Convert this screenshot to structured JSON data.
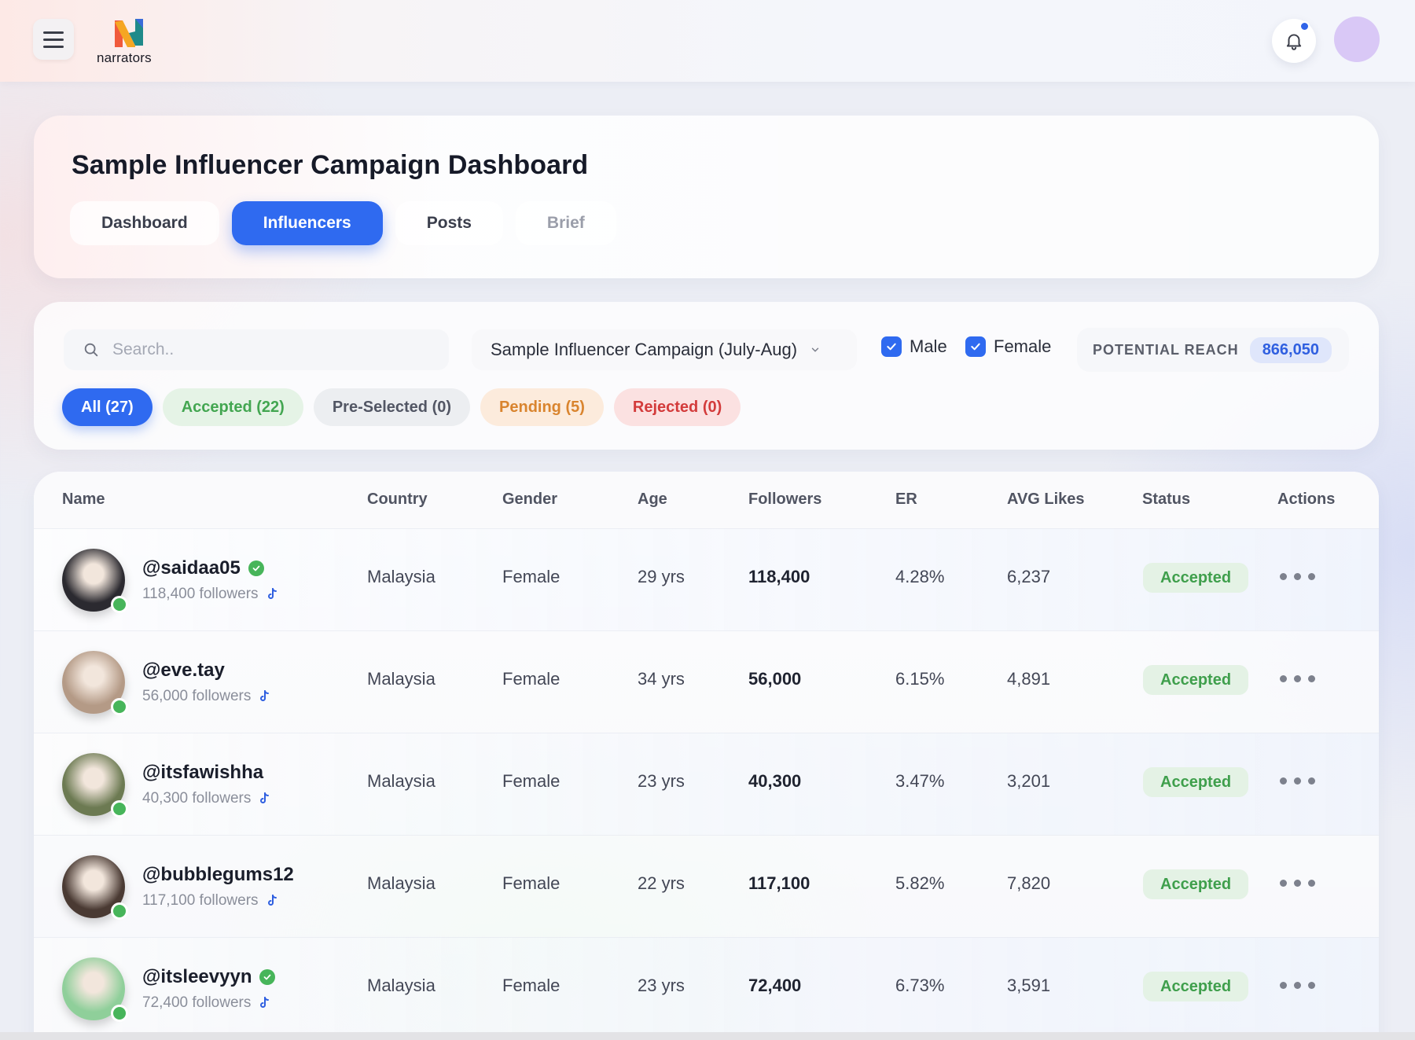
{
  "brand": {
    "name": "narrators"
  },
  "page": {
    "title": "Sample Influencer Campaign Dashboard"
  },
  "tabs": [
    {
      "label": "Dashboard",
      "state": "default"
    },
    {
      "label": "Influencers",
      "state": "active"
    },
    {
      "label": "Posts",
      "state": "default"
    },
    {
      "label": "Brief",
      "state": "muted"
    }
  ],
  "filters": {
    "search_placeholder": "Search..",
    "campaign": "Sample Influencer Campaign (July-Aug)",
    "gender_male": {
      "label": "Male",
      "checked": true
    },
    "gender_female": {
      "label": "Female",
      "checked": true
    },
    "potential_reach_label": "POTENTIAL REACH",
    "potential_reach_value": "866,050",
    "status_pills": [
      {
        "label": "All (27)",
        "kind": "all"
      },
      {
        "label": "Accepted (22)",
        "kind": "acc"
      },
      {
        "label": "Pre-Selected (0)",
        "kind": "pre"
      },
      {
        "label": "Pending (5)",
        "kind": "pen"
      },
      {
        "label": "Rejected (0)",
        "kind": "rej"
      }
    ]
  },
  "table": {
    "columns": {
      "name": "Name",
      "country": "Country",
      "gender": "Gender",
      "age": "Age",
      "followers": "Followers",
      "er": "ER",
      "avg_likes": "AVG Likes",
      "status": "Status",
      "actions": "Actions"
    },
    "rows": [
      {
        "handle": "@saidaa05",
        "verified": true,
        "followers_text": "118,400 followers",
        "country": "Malaysia",
        "gender": "Female",
        "age": "29 yrs",
        "followers": "118,400",
        "er": "4.28%",
        "avg_likes": "6,237",
        "status": "Accepted",
        "avatar_color": "#2b2a30"
      },
      {
        "handle": "@eve.tay",
        "verified": false,
        "followers_text": "56,000 followers",
        "country": "Malaysia",
        "gender": "Female",
        "age": "34 yrs",
        "followers": "56,000",
        "er": "6.15%",
        "avg_likes": "4,891",
        "status": "Accepted",
        "avatar_color": "#b49a86"
      },
      {
        "handle": "@itsfawishha",
        "verified": false,
        "followers_text": "40,300 followers",
        "country": "Malaysia",
        "gender": "Female",
        "age": "23 yrs",
        "followers": "40,300",
        "er": "3.47%",
        "avg_likes": "3,201",
        "status": "Accepted",
        "avatar_color": "#6c7a52"
      },
      {
        "handle": "@bubblegums12",
        "verified": false,
        "followers_text": "117,100 followers",
        "country": "Malaysia",
        "gender": "Female",
        "age": "22 yrs",
        "followers": "117,100",
        "er": "5.82%",
        "avg_likes": "7,820",
        "status": "Accepted",
        "avatar_color": "#4a3a33"
      },
      {
        "handle": "@itsleevyyn",
        "verified": true,
        "followers_text": "72,400 followers",
        "country": "Malaysia",
        "gender": "Female",
        "age": "23 yrs",
        "followers": "72,400",
        "er": "6.73%",
        "avg_likes": "3,591",
        "status": "Accepted",
        "avatar_color": "#8fcf9a"
      }
    ]
  },
  "colors": {
    "accent": "#2f6af0",
    "success": "#47b55a",
    "notification_dot": "#2f63e8"
  }
}
